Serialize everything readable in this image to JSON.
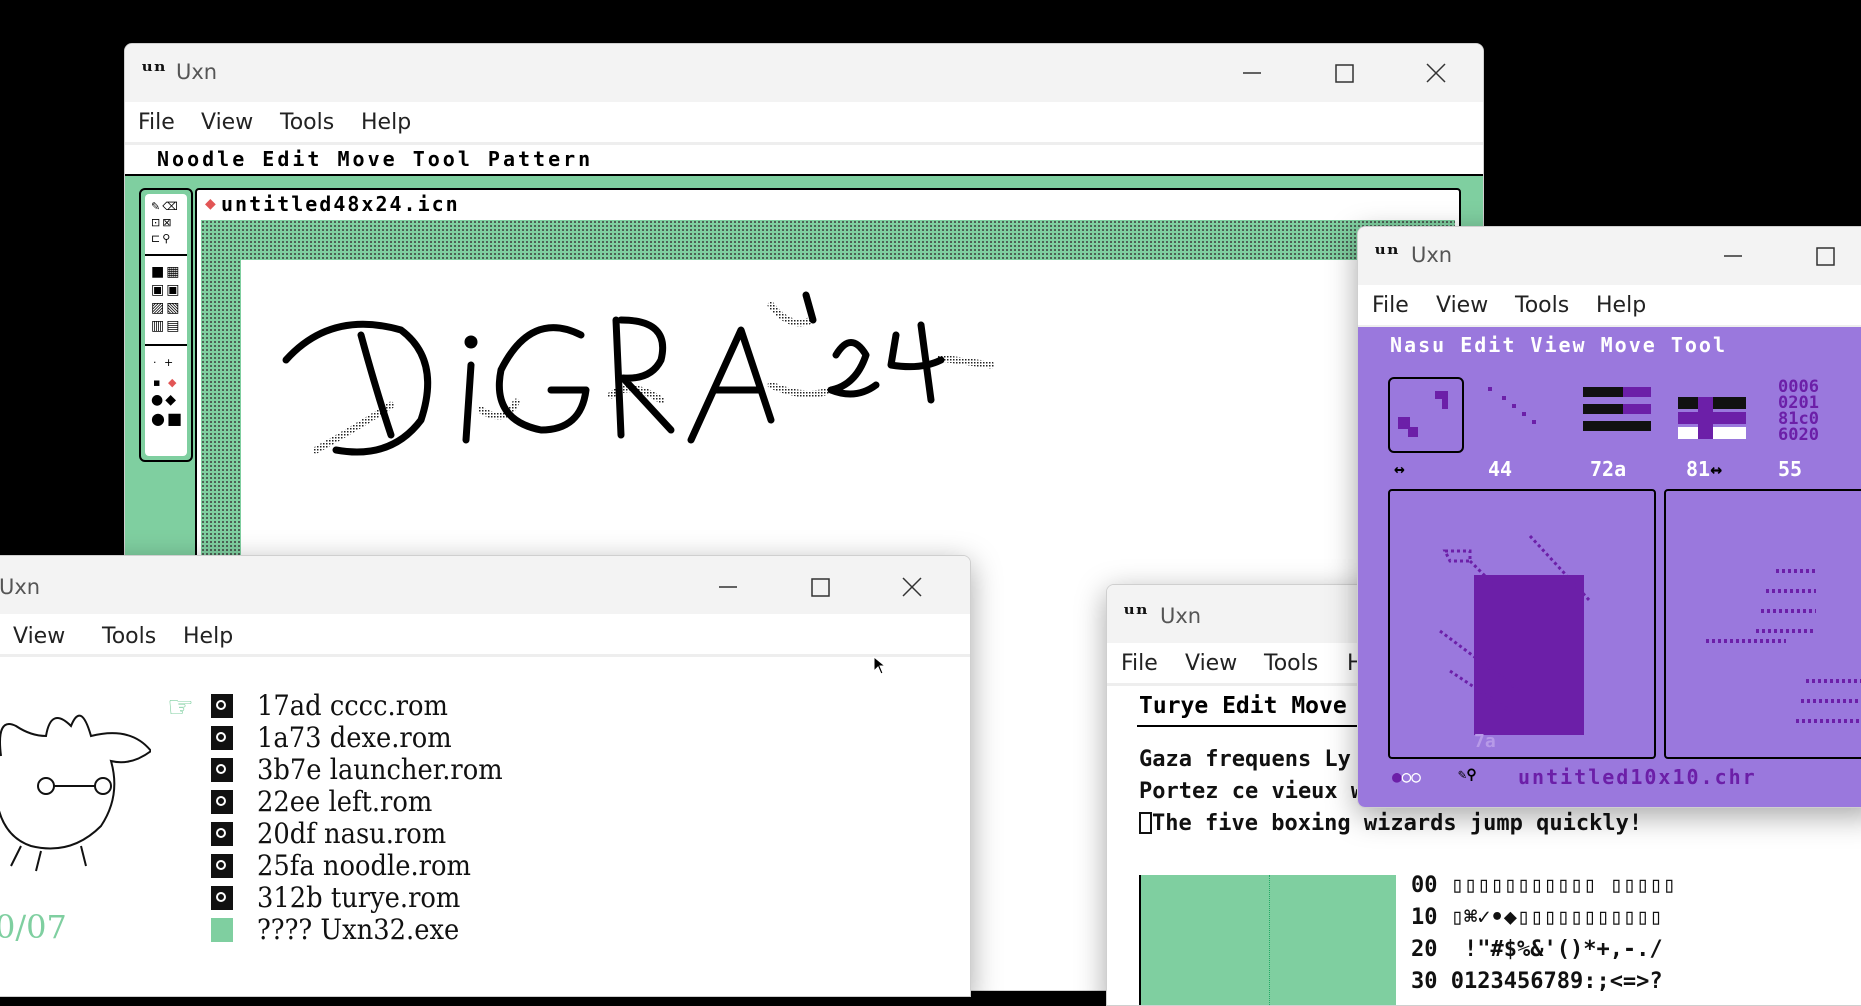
{
  "window_title": "Uxn",
  "menu": [
    "File",
    "View",
    "Tools",
    "Help"
  ],
  "noodle": {
    "title": "Uxn",
    "menu": [
      "File",
      "View",
      "Tools",
      "Help"
    ],
    "app_menu": "Noodle Edit Move Tool Pattern",
    "filename": "untitled48x24.icn",
    "drawing_text": "DiGRA '24"
  },
  "launcher": {
    "title": "Uxn",
    "menu": [
      "View",
      "Tools",
      "Help"
    ],
    "page_indicator": "0/07",
    "files": [
      {
        "addr": "17ad",
        "name": "cccc.rom",
        "icon": "rom-icon"
      },
      {
        "addr": "1a73",
        "name": "dexe.rom",
        "icon": "rom-icon"
      },
      {
        "addr": "3b7e",
        "name": "launcher.rom",
        "icon": "rom-icon"
      },
      {
        "addr": "22ee",
        "name": "left.rom",
        "icon": "rom-icon"
      },
      {
        "addr": "20df",
        "name": "nasu.rom",
        "icon": "rom-icon"
      },
      {
        "addr": "25fa",
        "name": "noodle.rom",
        "icon": "rom-icon"
      },
      {
        "addr": "312b",
        "name": "turye.rom",
        "icon": "rom-icon"
      },
      {
        "addr": "????",
        "name": "Uxn32.exe",
        "icon": "document-icon"
      }
    ]
  },
  "turye": {
    "title": "Uxn",
    "menu": [
      "File",
      "View",
      "Tools",
      "H"
    ],
    "app_menu": "Turye Edit Move",
    "samples": [
      "Gaza frequens Ly",
      "Portez ce vieux w",
      "The five boxing wizards jump quickly!"
    ],
    "charmap": [
      {
        "row": "00",
        "chars": "▯▯▯▯▯▯▯▯▯▯▯ ▯▯▯▯▯"
      },
      {
        "row": "10",
        "chars": "▯⌘✓•◆▯▯▯▯▯▯▯▯▯▯▯"
      },
      {
        "row": "20",
        "chars": " !\"#$%&'()*+,-./"
      },
      {
        "row": "30",
        "chars": "0123456789:;<=>?"
      }
    ]
  },
  "nasu": {
    "title": "Uxn",
    "menu": [
      "File",
      "View",
      "Tools",
      "Help"
    ],
    "app_menu": "Nasu Edit View Move Tool",
    "hex": [
      "0006",
      "0201",
      "81c0",
      "6020"
    ],
    "labels": [
      "44",
      "72a",
      "81",
      "55"
    ],
    "tile_label": "7a",
    "filename": "untitled10x10.chr"
  },
  "colors": {
    "noodle_green": "#7fcfa0",
    "nasu_purple": "#9a78dd",
    "nasu_dark": "#6c1fa8",
    "accent_red": "#e25555"
  }
}
